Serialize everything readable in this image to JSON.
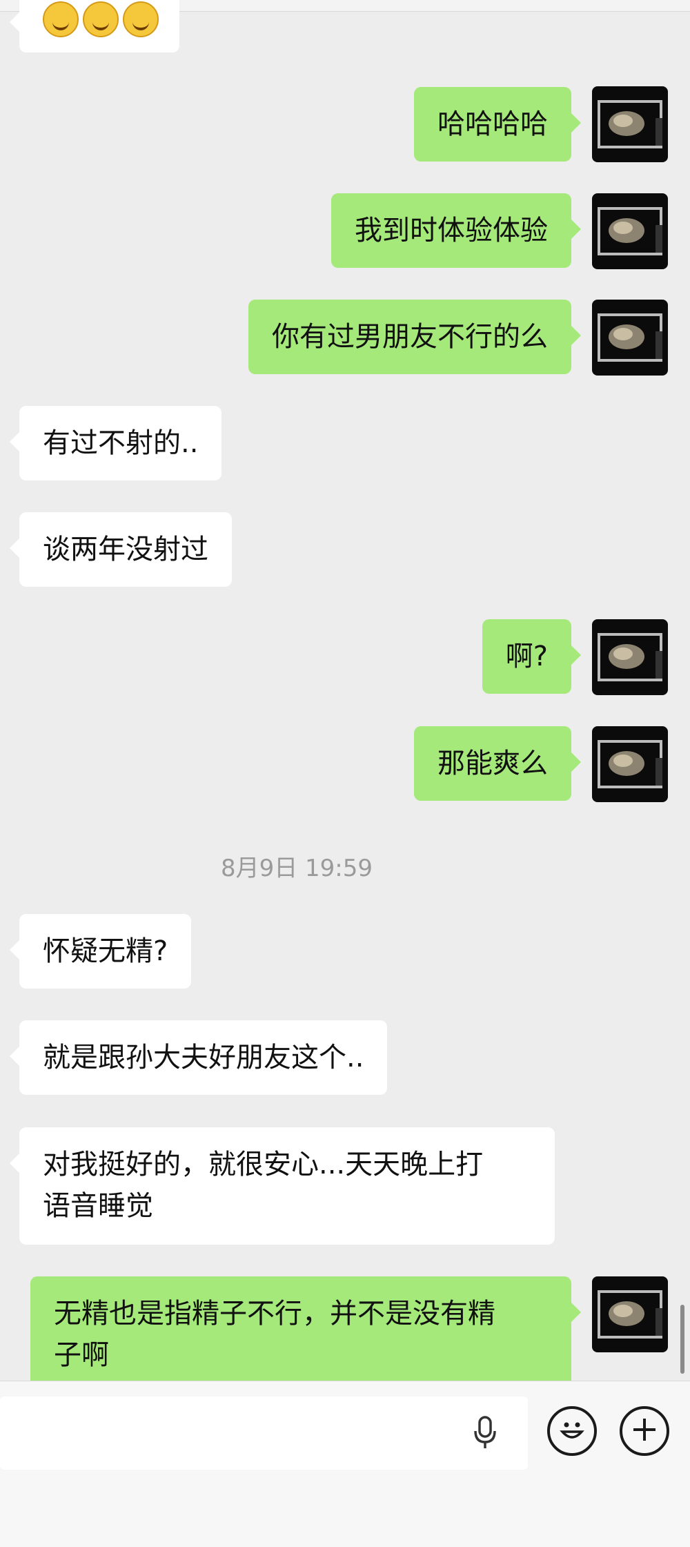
{
  "top_emojis": [
    "smile-emoji",
    "smile-emoji",
    "smile-emoji"
  ],
  "messages": [
    {
      "side": "me",
      "text": "哈哈哈哈"
    },
    {
      "side": "me",
      "text": "我到时体验体验"
    },
    {
      "side": "me",
      "text": "你有过男朋友不行的么"
    },
    {
      "side": "them",
      "text": "有过不射的.."
    },
    {
      "side": "them",
      "text": "谈两年没射过"
    },
    {
      "side": "me",
      "text": "啊?"
    },
    {
      "side": "me",
      "text": "那能爽么"
    },
    {
      "side": "them",
      "text": "怀疑无精?"
    },
    {
      "side": "them",
      "text": "就是跟孙大夫好朋友这个.."
    },
    {
      "side": "them",
      "text": "对我挺好的，就很安心...天天晚上打\n语音睡觉"
    },
    {
      "side": "me",
      "text": "无精也是指精子不行，并不是没有精\n子啊"
    }
  ],
  "timestamp": "8月9日 19:59",
  "input": {
    "value": "",
    "placeholder": ""
  },
  "icons": {
    "voice": "microphone-icon",
    "emoji": "emoji-icon",
    "more": "plus-icon"
  },
  "colors": {
    "background": "#ededed",
    "my_bubble": "#a6e97b",
    "their_bubble": "#ffffff"
  }
}
